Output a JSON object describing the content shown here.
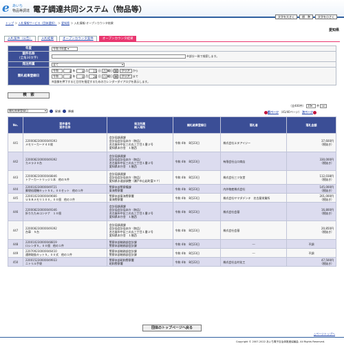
{
  "header": {
    "logo_mark": "e",
    "logo_aichi": "あいち",
    "logo_sub": "物品等調達",
    "system_title": "電子調達共同システム（物品等）",
    "buttons": [
      "文字を大きく",
      "標　準",
      "文字を小さく"
    ]
  },
  "breadcrumb": {
    "items": [
      "トップ",
      "入札情報サービス（団体選択）",
      "愛知県"
    ],
    "current": "入札情報-オープンカウンタ結果",
    "sep": " ＞ "
  },
  "region": "愛知県",
  "tabs": [
    "入札案件（公告）",
    "入札結果",
    "オープンカウンタ案件",
    "オープンカウンタ結果"
  ],
  "form": {
    "fiscal_year": {
      "label": "年度",
      "value": "令和 4年度"
    },
    "case_name": {
      "label": "案件名称",
      "sublabel": "(全角30文字)",
      "note": "※部分一致で検索します。"
    },
    "department": {
      "label": "発注所属",
      "value": "全て"
    },
    "date": {
      "label": "開札結果登録日",
      "from": {
        "era": "令和",
        "year": "4",
        "month": "8",
        "day": "15"
      },
      "to": {
        "era": "令和",
        "year": "4",
        "month": "8",
        "day": "28"
      },
      "unit_year": "年",
      "unit_month": "月",
      "unit_day": "日",
      "from_day_of_week": "月",
      "to_day_of_week": "日",
      "weekday_label": "曜日",
      "clear": "クリア",
      "from_suffix": "から",
      "to_suffix": "まで",
      "note": "※画像を押下すると日付を指定するためのカレンダーダイアログを表示します。"
    },
    "search_button": "検　索"
  },
  "list": {
    "sort_select": "開札結果登録日",
    "asc": "昇順",
    "desc": "降順",
    "count_text": "（全400件）",
    "per_page": "10",
    "per_page_unit": "件",
    "prev_page": "前ページ",
    "page_info": "（41/40ページ）",
    "next_page": "次ページ",
    "headers": {
      "no": "No.",
      "case": [
        "案件番号",
        "案件名称"
      ],
      "dept": [
        "発注所属",
        "納入場所"
      ],
      "date": "開札結果登録日",
      "winner": "落札者",
      "amount": "落札金額"
    }
  },
  "rows": [
    {
      "no": "441",
      "case_no": "220008230000049393",
      "case_name": "メモリーカード４０枚",
      "dept": [
        "会計局調達課",
        "会計局会計局本庁（物品）",
        "名古屋市中区三の丸三丁目１番２号",
        "愛知県本庁舎　１階西"
      ],
      "date": "令和 4年　8月23日",
      "winner": "株式会社エヌアイジー",
      "amount": "37,600円",
      "tax": "（税抜き）"
    },
    {
      "no": "442",
      "case_no": "220008230000049392",
      "case_name": "カメラ２０台",
      "dept": [
        "会計局調達課",
        "会計局会計局本庁（物品）",
        "名古屋市中区三の丸三丁目１番２号",
        "愛知県本庁舎　１階西"
      ],
      "date": "令和 4年　8月23日",
      "winner": "有限会社山口商店",
      "amount": "330,000円",
      "tax": "（税抜き）"
    },
    {
      "no": "443",
      "case_no": "220008230000048846",
      "case_name": "トナーカートリッジ１本　他の５件",
      "dept": [
        "会計局調達課",
        "会計局会計局本庁（物品）",
        "愛知県水道部調整（瀬戸市山岩町富９７）"
      ],
      "date": "令和 4年　8月23日",
      "winner": "株式会社三ツ矢堂",
      "amount": "112,038円",
      "tax": "（税抜き）"
    },
    {
      "no": "444",
      "case_no": "220010230000049721",
      "case_name": "郵袋処理機キット５０，００セット　他の１件",
      "dept": [
        "警察本部警察備課",
        "東海警察署"
      ],
      "date": "令和 4年　8月23日",
      "winner": "内外物産株式会社",
      "amount": "145,000円",
      "tax": "（税抜き）"
    },
    {
      "no": "445",
      "case_no": "220010230000049666",
      "case_name": "ＵＳＢメモリ１００，００個　他の３件",
      "dept": [
        "警察本部東海警察署",
        "東海警察署"
      ],
      "date": "令和 4年　8月23日",
      "winner": "株式会社ヤマダデンキ　名古屋栄業所",
      "amount": "201,000円",
      "tax": "（税抜き）"
    },
    {
      "no": "446",
      "case_no": "220008230000049346",
      "case_name": "折りたたみコンテナ　１０個",
      "dept": [
        "会計局調達課",
        "会計局会計局本庁（物品）",
        "名古屋市中区三の丸三丁目１番２号",
        "愛知県本庁舎　１階西"
      ],
      "date": "令和 4年　8月23日",
      "winner": "株式会社会基",
      "amount": "16,800円",
      "tax": "（税抜き）"
    },
    {
      "no": "447",
      "case_no": "220008230000049392",
      "case_name": "台車　５台",
      "dept": [
        "会計局調達課",
        "会計局会計局本庁（物品）",
        "名古屋市中区三の丸三丁目１番２号",
        "愛知県本庁舎　１階西"
      ],
      "date": "令和 4年　8月23日",
      "winner": "株式会社会基",
      "amount": "20,850円",
      "tax": "（税抜き）"
    },
    {
      "no": "448",
      "case_no": "220010230000048819",
      "case_name": "ロシンダ５，００個　他の１件",
      "dept": [
        "警察本部総務部会計課",
        "警察本部総務部会計課"
      ],
      "date": "令和 4年　8月23日",
      "winner": "---",
      "amount": "不調",
      "tax": ""
    },
    {
      "no": "449",
      "case_no": "220709230000046410",
      "case_name": "通称取扱キット５，００式　他の１件",
      "dept": [
        "警察本部総務部会計課",
        "警察本部総務部会計課"
      ],
      "date": "令和 4年　8月23日",
      "winner": "---",
      "amount": "不調",
      "tax": ""
    },
    {
      "no": "450",
      "case_no": "220015230000049933",
      "case_name": "ニトリル手袋",
      "dept": [
        "警察本部昭和警察署",
        "昭和警察署"
      ],
      "date": "令和 4年　8月22日",
      "winner": "株式会社吉村化工",
      "amount": "47,500円",
      "tax": "（税抜き）"
    }
  ],
  "back_button": "団体のトップページへ戻る",
  "to_top": "△ページトップへ",
  "copyright": "Copyright © 2007-2022 あいち電子自治体推進協議会. All Rights Reserved."
}
